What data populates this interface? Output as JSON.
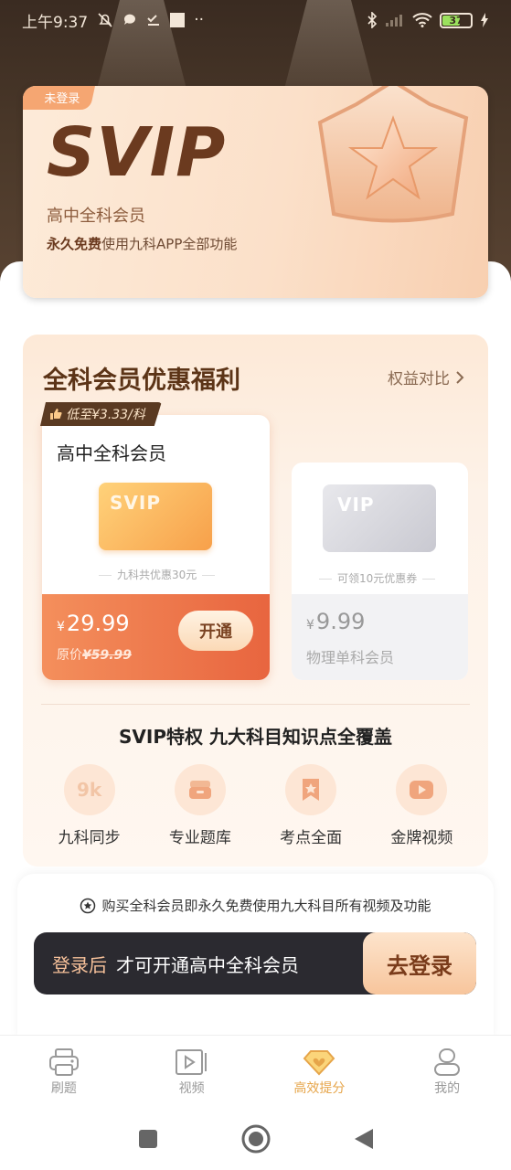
{
  "status_bar": {
    "time": "上午9:37",
    "extra": "··",
    "battery": "37"
  },
  "svip_card": {
    "tag": "未登录",
    "logo": "SVIP",
    "subtitle": "高中全科会员",
    "desc_bold": "永久免费",
    "desc_rest": "使用九科APP全部功能"
  },
  "benefits": {
    "title": "全科会员优惠福利",
    "compare_label": "权益对比",
    "ribbon": "低至¥3.33/科",
    "main_plan": {
      "name": "高中全科会员",
      "card_label": "SVIP",
      "note": "九科共优惠30元",
      "currency": "¥",
      "price": "29.99",
      "orig_prefix": "原价",
      "orig_price": "¥59.99",
      "button": "开通"
    },
    "alt_plan": {
      "card_label": "VIP",
      "note": "可领10元优惠券",
      "currency": "¥",
      "price": "9.99",
      "name": "物理单科会员"
    },
    "privilege_title": "SVIP特权   九大科目知识点全覆盖",
    "privileges": [
      {
        "label": "九科同步",
        "icon": "9k"
      },
      {
        "label": "专业题库",
        "icon": "question-bank-icon"
      },
      {
        "label": "考点全面",
        "icon": "bookmark-star-icon"
      },
      {
        "label": "金牌视频",
        "icon": "video-play-icon"
      }
    ]
  },
  "login": {
    "notice": "购买全科会员即永久免费使用九大科目所有视频及功能",
    "highlight": "登录后",
    "text": "才可开通高中全科会员",
    "button": "去登录"
  },
  "tabbar": {
    "items": [
      {
        "label": "刷题",
        "icon": "printer-icon"
      },
      {
        "label": "视频",
        "icon": "video-icon"
      },
      {
        "label": "高效提分",
        "icon": "diamond-heart-icon"
      },
      {
        "label": "我的",
        "icon": "user-icon"
      }
    ],
    "active_index": 2
  },
  "colors": {
    "accent": "#e8653f",
    "gold": "#e6a54a",
    "brown": "#6b3a1f"
  }
}
